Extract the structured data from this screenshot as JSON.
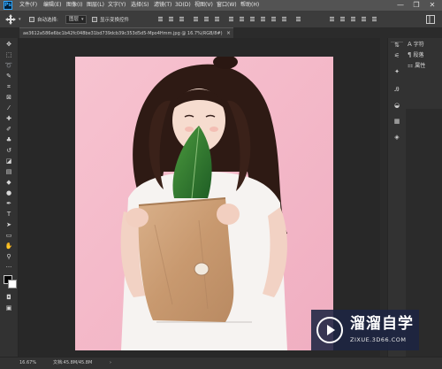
{
  "app": {
    "logo": "Ps",
    "menu": [
      "文件(F)",
      "编辑(E)",
      "图像(I)",
      "图层(L)",
      "文字(Y)",
      "选择(S)",
      "滤镜(T)",
      "3D(D)",
      "视图(V)",
      "窗口(W)",
      "帮助(H)"
    ],
    "window_controls": [
      "—",
      "❐",
      "✕"
    ]
  },
  "options_bar": {
    "auto_select_label": "自动选择:",
    "auto_select_value": "图层",
    "show_transform_label": "显示变换控件"
  },
  "document": {
    "tab_label": "ae3612a586e6bc1b42fc048be31bd739dcb39c353d5d5-Mpo4Hmm.jpg @ 16.7%(RGB/8#)",
    "close": "×"
  },
  "panels": {
    "character_label": "字符",
    "paragraph_label": "段落",
    "properties_label": "属性"
  },
  "status": {
    "zoom": "16.67%",
    "doc_size": "文档:45.8M/45.8M"
  },
  "watermark": {
    "title": "溜溜自学",
    "url": "ZIXUE.3D66.COM"
  },
  "colors": {
    "chrome_dark": "#2b2b2b",
    "menu_bar": "#535353",
    "photo_background": "#f4b8c8",
    "ps_blue": "#31a8ff",
    "watermark_bg": "#1c2442"
  }
}
